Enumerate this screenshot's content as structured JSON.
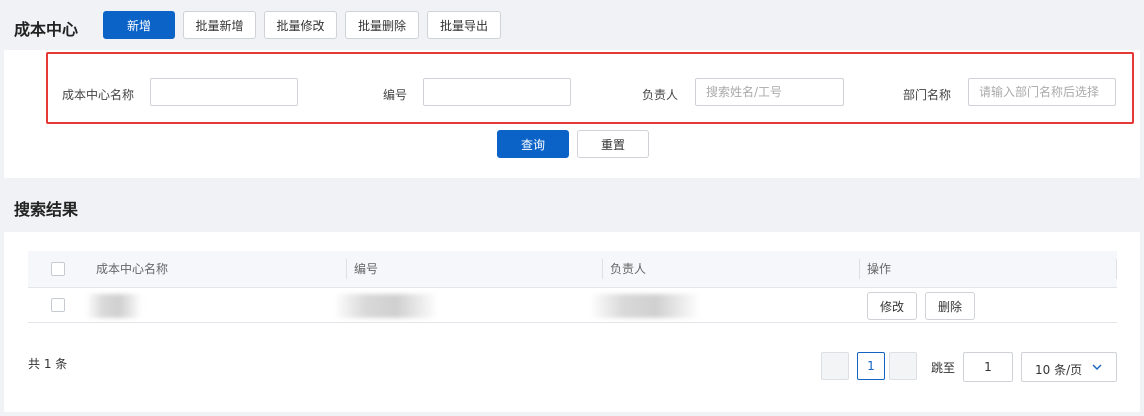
{
  "header": {
    "title": "成本中心",
    "buttons": {
      "add": "新增",
      "batch_add": "批量新增",
      "batch_edit": "批量修改",
      "batch_delete": "批量删除",
      "batch_export": "批量导出"
    }
  },
  "filters": {
    "name_label": "成本中心名称",
    "name_value": "",
    "code_label": "编号",
    "code_value": "",
    "owner_label": "负责人",
    "owner_placeholder": "搜索姓名/工号",
    "dept_label": "部门名称",
    "dept_placeholder": "请输入部门名称后选择",
    "query_button": "查询",
    "reset_button": "重置"
  },
  "results": {
    "title": "搜索结果",
    "columns": [
      "成本中心名称",
      "编号",
      "负责人",
      "操作"
    ],
    "row_actions": {
      "edit": "修改",
      "delete": "删除"
    },
    "total": "共 1 条",
    "pagination": {
      "current_page": "1",
      "jump_label": "跳至",
      "jump_value": "1",
      "page_size": "10 条/页"
    }
  },
  "colors": {
    "primary": "#1565c0",
    "highlight": "#e53935",
    "background": "#f0f2f5"
  }
}
